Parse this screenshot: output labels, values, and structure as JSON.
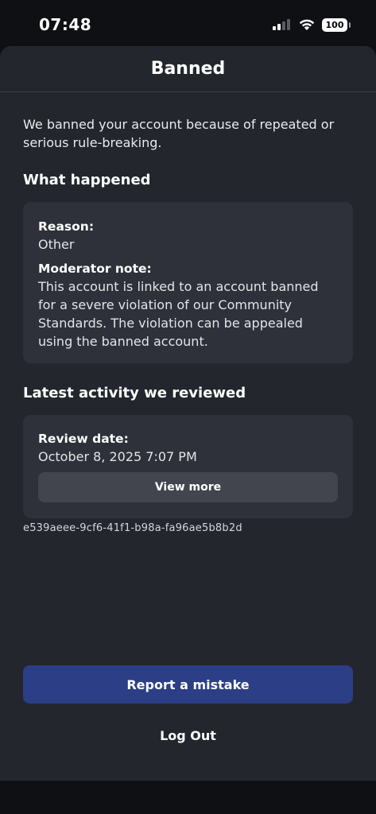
{
  "status_bar": {
    "time": "07:48",
    "battery": "100",
    "icons": [
      "cellular-signal-icon",
      "wifi-icon",
      "battery-icon"
    ]
  },
  "header": {
    "title": "Banned"
  },
  "intro": "We banned your account because of repeated or serious rule-breaking.",
  "what_happened": {
    "title": "What happened",
    "reason_label": "Reason:",
    "reason_value": "Other",
    "note_label": "Moderator note:",
    "note_value": "This account is linked to an account banned for a severe violation of our Community Standards. The violation can be appealed using the banned account."
  },
  "latest_activity": {
    "title": "Latest activity we reviewed",
    "review_date_label": "Review date:",
    "review_date_value": "October 8, 2025 7:07 PM",
    "view_more_label": "View more"
  },
  "reference_id": "e539aeee-9cf6-41f1-b98a-fa96ae5b8b2d",
  "actions": {
    "report_label": "Report a mistake",
    "logout_label": "Log Out"
  },
  "colors": {
    "background": "#23262d",
    "card": "#2e3139",
    "primary_button": "#2c3e85",
    "secondary_button": "#42454e"
  }
}
